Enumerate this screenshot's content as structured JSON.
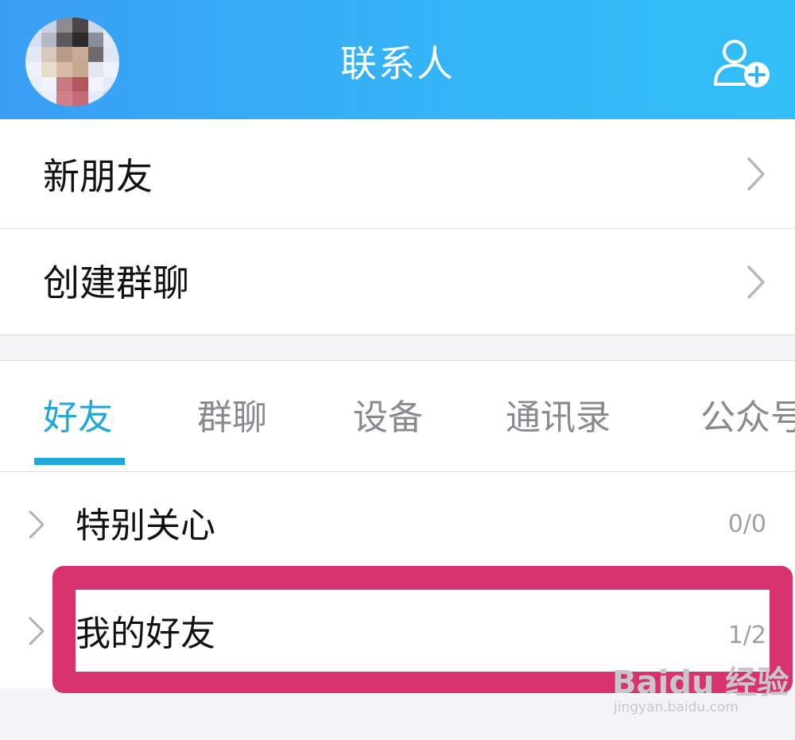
{
  "header": {
    "title": "联系人",
    "avatar_icon": "user-avatar",
    "add_icon": "add-contact-icon",
    "colors": {
      "gradient_start": "#3a9ef5",
      "gradient_end": "#33bff8"
    }
  },
  "menu": [
    {
      "label": "新朋友",
      "icon": "chevron-right-icon"
    },
    {
      "label": "创建群聊",
      "icon": "chevron-right-icon"
    }
  ],
  "tabs": {
    "items": [
      {
        "label": "好友",
        "active": true
      },
      {
        "label": "群聊",
        "active": false
      },
      {
        "label": "设备",
        "active": false
      },
      {
        "label": "通讯录",
        "active": false
      },
      {
        "label": "公众号",
        "active": false
      }
    ],
    "accent": "#20a7dc"
  },
  "groups": [
    {
      "name": "特别关心",
      "count": "0/0"
    },
    {
      "name": "我的好友",
      "count": "1/2",
      "highlighted": true
    }
  ],
  "highlight_color": "#d8336e",
  "watermark": {
    "brand": "Baidu 经验",
    "url": "jingyan.baidu.com"
  }
}
